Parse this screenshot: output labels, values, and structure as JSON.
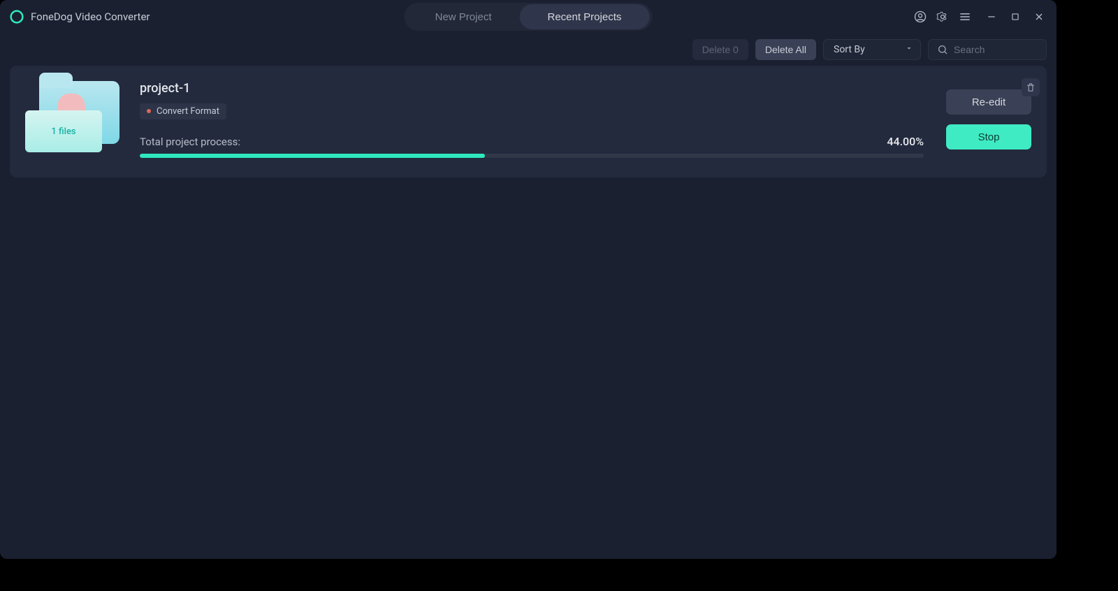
{
  "brand": {
    "name": "FoneDog Video Converter"
  },
  "tabs": {
    "new_project": "New Project",
    "recent_projects": "Recent Projects"
  },
  "toolbar": {
    "delete_selected": "Delete 0",
    "delete_all": "Delete All",
    "sort_by": "Sort By",
    "search_placeholder": "Search"
  },
  "project": {
    "title": "project-1",
    "file_count_label": "1 files",
    "tag_label": "Convert Format",
    "progress_label": "Total project process:",
    "progress_pct_text": "44.00%",
    "progress_pct_css": "44%",
    "reedit_label": "Re-edit",
    "stop_label": "Stop"
  }
}
